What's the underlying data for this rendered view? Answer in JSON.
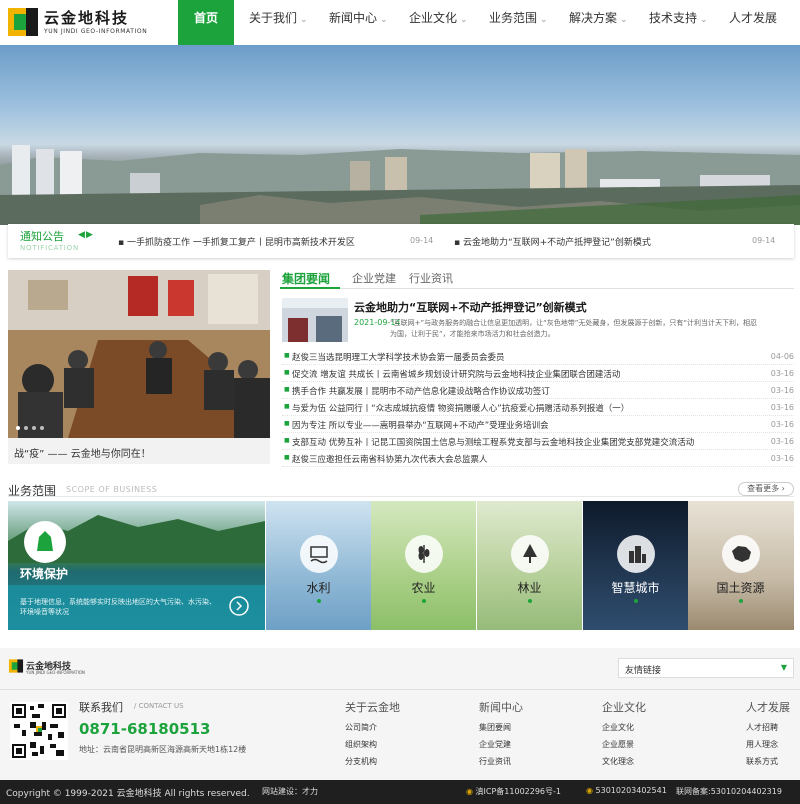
{
  "brand": {
    "name_cn": "云金地科技",
    "name_en": "YUN JINDI GEO-INFORMATION"
  },
  "nav": [
    {
      "label": "首页",
      "active": true
    },
    {
      "label": "关于我们"
    },
    {
      "label": "新闻中心"
    },
    {
      "label": "企业文化"
    },
    {
      "label": "业务范围"
    },
    {
      "label": "解决方案"
    },
    {
      "label": "技术支持"
    },
    {
      "label": "人才发展"
    }
  ],
  "notice": {
    "title": "通知公告",
    "subtitle": "NOTIFICATION",
    "items": [
      {
        "text": "一手抓防疫工作 一手抓复工复产丨昆明市高新技术开发区",
        "date": "09-14"
      },
      {
        "text": "云金地助力“互联网+不动产抵押登记”创新模式",
        "date": "09-14"
      }
    ]
  },
  "photo": {
    "caption": "战“疫” —— 云金地与你同在！"
  },
  "news": {
    "tabs": [
      "集团要闻",
      "企业党建",
      "行业资讯"
    ],
    "featured": {
      "title": "云金地助力“互联网+不动产抵押登记”创新模式",
      "date": "2021-09-14",
      "summary": "“互联网+”与政务服务的融合让信息更加透明，让“灰色地带”无处藏身，但发展源于创新，只有“计利当计天下利，相忍为国，让利于民”，才能抢来市场活力和社会创造力。"
    },
    "items": [
      {
        "title": "赵俊三当选昆明理工大学科学技术协会第一届委员会委员",
        "date": "04-06"
      },
      {
        "title": "促交流 增友谊 共成长丨云南省城乡规划设计研究院与云金地科技企业集团联合团建活动",
        "date": "03-16"
      },
      {
        "title": "携手合作 共赢发展丨昆明市不动产信息化建设战略合作协议成功签订",
        "date": "03-16"
      },
      {
        "title": "与爱为伍 公益同行丨“众志成城抗疫情 物资捐赠暖人心”抗疫爱心捐赠活动系列报道（一）",
        "date": "03-16"
      },
      {
        "title": "因为专注 所以专业——嵩明县举办“互联网+不动产”受理业务培训会",
        "date": "03-16"
      },
      {
        "title": "支部互动 优势互补丨记昆工国资院国土信息与测绘工程系党支部与云金地科技企业集团党支部党建交流活动",
        "date": "03-16"
      },
      {
        "title": "赵俊三应邀担任云南省科协第九次代表大会总监票人",
        "date": "03-16"
      }
    ]
  },
  "business": {
    "title": "业务范围",
    "subtitle": "SCOPE OF BUSINESS",
    "more": "查看更多",
    "main": {
      "title": "环境保护",
      "desc": "基于地理信息，系统能够实时反映出地区的大气污染、水污染、环境噪音等状况"
    },
    "tiles": [
      {
        "label": "水利",
        "icon": "water-icon"
      },
      {
        "label": "农业",
        "icon": "wheat-icon"
      },
      {
        "label": "林业",
        "icon": "tree-icon"
      },
      {
        "label": "智慧城市",
        "icon": "city-icon"
      },
      {
        "label": "国土资源",
        "icon": "china-map-icon"
      }
    ]
  },
  "footer": {
    "links_label": "友情链接",
    "contact_title": "联系我们",
    "contact_title_en": "/ CONTACT US",
    "phone": "0871-68180513",
    "address": "地址：云南省昆明高新区海源高新天地1栋12楼",
    "columns": [
      {
        "title": "关于云金地",
        "items": [
          "公司简介",
          "组织架构",
          "分支机构"
        ]
      },
      {
        "title": "新闻中心",
        "items": [
          "集团要闻",
          "企业党建",
          "行业资讯"
        ]
      },
      {
        "title": "企业文化",
        "items": [
          "企业文化",
          "企业愿景",
          "文化理念"
        ]
      },
      {
        "title": "人才发展",
        "items": [
          "人才招聘",
          "用人理念",
          "联系方式"
        ]
      }
    ],
    "copyright": "Copyright © 1999-2021 云金地科技 All rights reserved.",
    "built": "网站建设：才力",
    "icp": "滇ICP备11002296号-1",
    "police": "53010203402541",
    "police_record": "联网备案:53010204402319"
  },
  "colors": {
    "accent": "#1ca33c",
    "bottom_bar": "#1f1f1f"
  }
}
